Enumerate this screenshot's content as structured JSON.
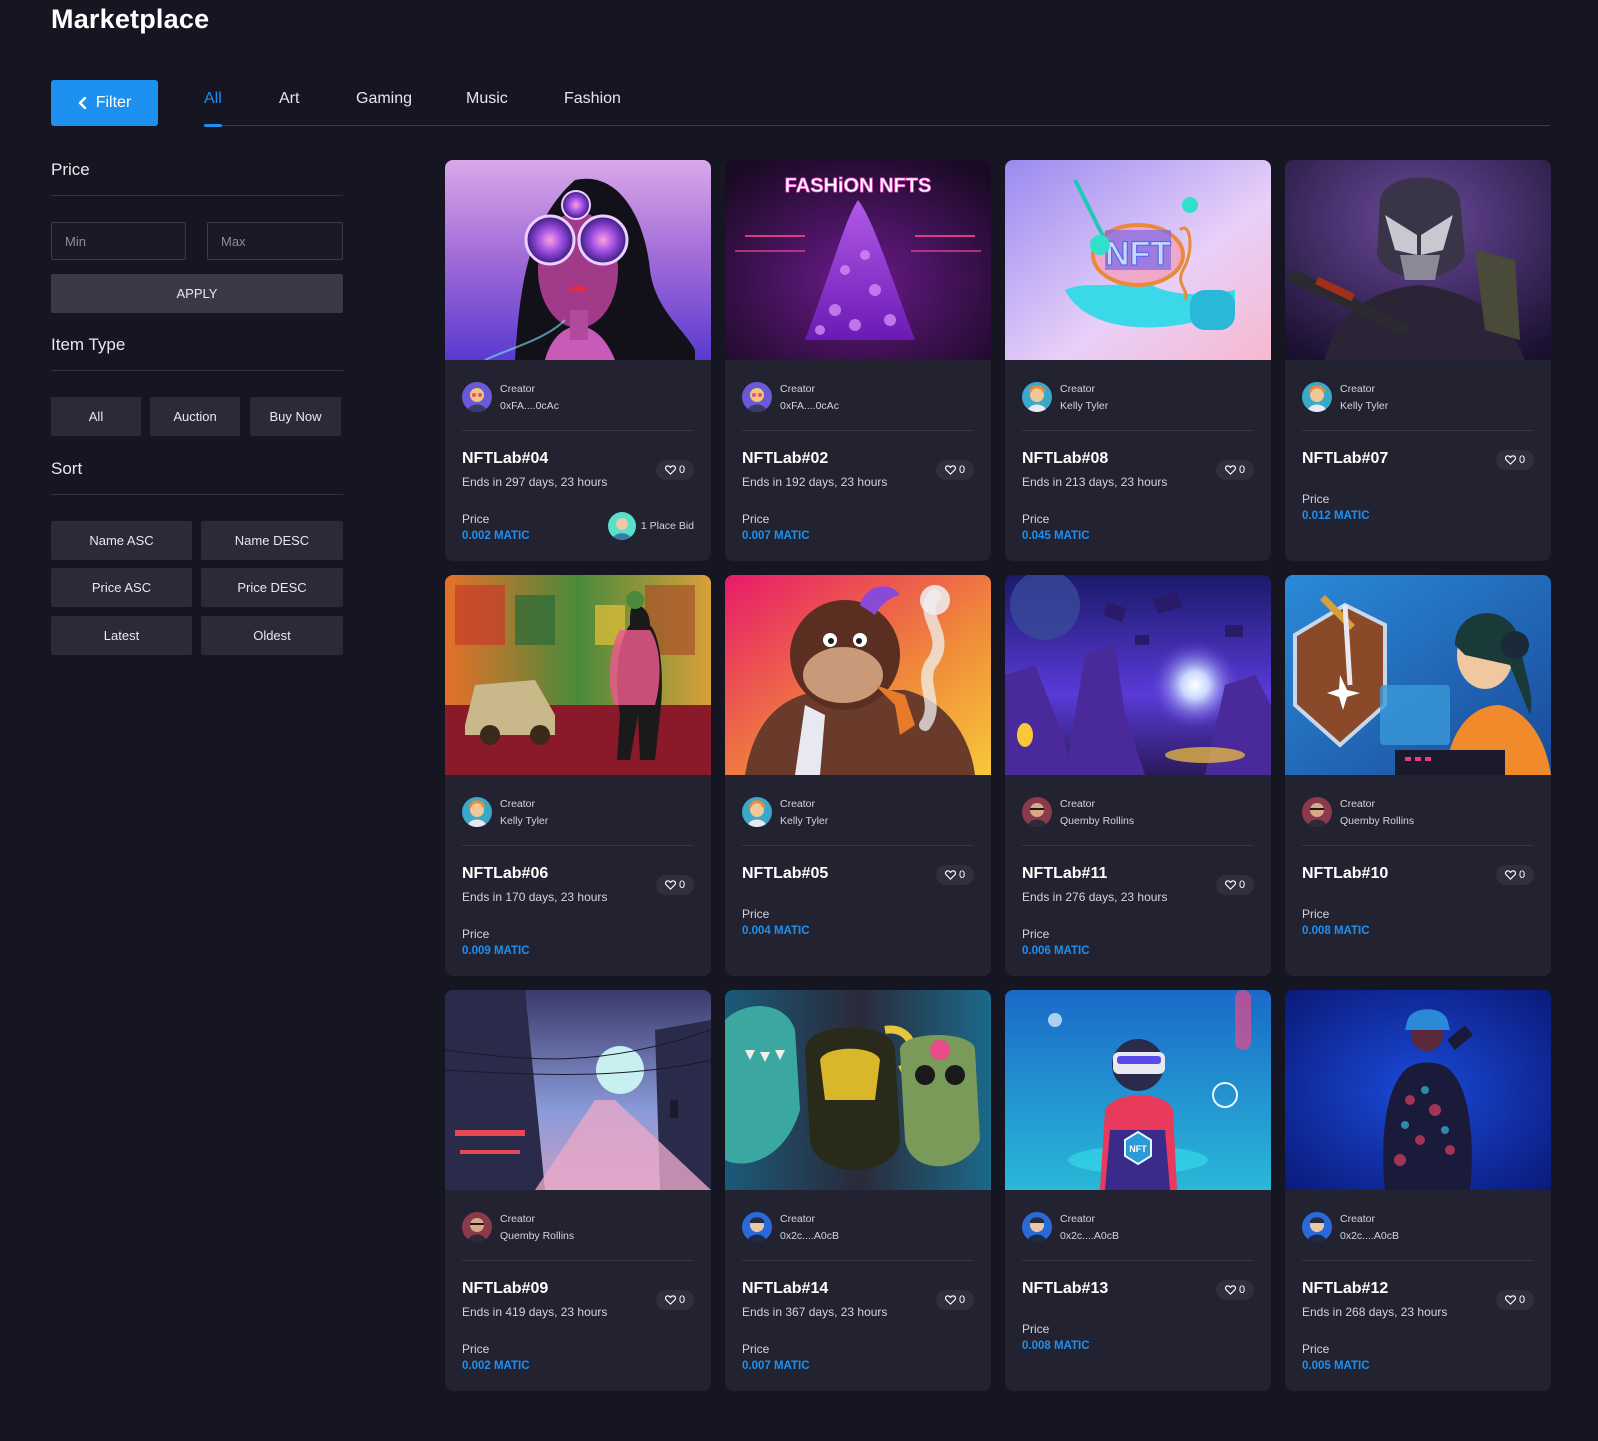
{
  "page_title": "Marketplace",
  "filter_button": "Filter",
  "tabs": [
    {
      "label": "All",
      "active": true
    },
    {
      "label": "Art"
    },
    {
      "label": "Gaming"
    },
    {
      "label": "Music"
    },
    {
      "label": "Fashion"
    }
  ],
  "sidebar": {
    "price_title": "Price",
    "min_placeholder": "Min",
    "max_placeholder": "Max",
    "apply_label": "APPLY",
    "item_type_title": "Item Type",
    "item_types": [
      "All",
      "Auction",
      "Buy Now"
    ],
    "sort_title": "Sort",
    "sort_options": [
      "Name ASC",
      "Name DESC",
      "Price ASC",
      "Price DESC",
      "Latest",
      "Oldest"
    ]
  },
  "accent_color": "#1e90f0",
  "cards": [
    {
      "name": "NFTLab#04",
      "creator_label": "Creator",
      "creator": "0xFA....0cAc",
      "ends": "Ends in 297 days, 23 hours",
      "likes": "0",
      "price_label": "Price",
      "price": "0.002 MATIC",
      "bid_text": "1 Place Bid",
      "art": "woman-cosmic-glasses"
    },
    {
      "name": "NFTLab#02",
      "creator_label": "Creator",
      "creator": "0xFA....0cAc",
      "ends": "Ends in 192 days, 23 hours",
      "likes": "0",
      "price_label": "Price",
      "price": "0.007 MATIC",
      "art": "fashion-nfts-dress",
      "art_text": "FASHiON NFTS"
    },
    {
      "name": "NFTLab#08",
      "creator_label": "Creator",
      "creator": "Kelly Tyler",
      "ends": "Ends in 213 days, 23 hours",
      "likes": "0",
      "price_label": "Price",
      "price": "0.045 MATIC",
      "art": "music-nft-hand",
      "art_text": "NFT"
    },
    {
      "name": "NFTLab#07",
      "creator_label": "Creator",
      "creator": "Kelly Tyler",
      "likes": "0",
      "price_label": "Price",
      "price": "0.012 MATIC",
      "art": "armored-soldier"
    },
    {
      "name": "NFTLab#06",
      "creator_label": "Creator",
      "creator": "Kelly Tyler",
      "ends": "Ends in 170 days, 23 hours",
      "likes": "0",
      "price_label": "Price",
      "price": "0.009 MATIC",
      "art": "fashion-street-car"
    },
    {
      "name": "NFTLab#05",
      "creator_label": "Creator",
      "creator": "Kelly Tyler",
      "likes": "0",
      "price_label": "Price",
      "price": "0.004 MATIC",
      "art": "gorilla-pipe"
    },
    {
      "name": "NFTLab#11",
      "creator_label": "Creator",
      "creator": "Quemby Rollins",
      "ends": "Ends in 276 days, 23 hours",
      "likes": "0",
      "price_label": "Price",
      "price": "0.006 MATIC",
      "art": "purple-planet-landscape"
    },
    {
      "name": "NFTLab#10",
      "creator_label": "Creator",
      "creator": "Quemby Rollins",
      "likes": "0",
      "price_label": "Price",
      "price": "0.008 MATIC",
      "art": "gamer-girl-shield"
    },
    {
      "name": "NFTLab#09",
      "creator_label": "Creator",
      "creator": "Quemby Rollins",
      "ends": "Ends in 419 days, 23 hours",
      "likes": "0",
      "price_label": "Price",
      "price": "0.002 MATIC",
      "art": "city-street-moon"
    },
    {
      "name": "NFTLab#14",
      "creator_label": "Creator",
      "creator": "0x2c....A0cB",
      "ends": "Ends in 367 days, 23 hours",
      "likes": "0",
      "price_label": "Price",
      "price": "0.007 MATIC",
      "art": "monster-figures"
    },
    {
      "name": "NFTLab#13",
      "creator_label": "Creator",
      "creator": "0x2c....A0cB",
      "likes": "0",
      "price_label": "Price",
      "price": "0.008 MATIC",
      "art": "vr-gamer",
      "art_text": "NFT"
    },
    {
      "name": "NFTLab#12",
      "creator_label": "Creator",
      "creator": "0x2c....A0cB",
      "ends": "Ends in 268 days, 23 hours",
      "likes": "0",
      "price_label": "Price",
      "price": "0.005 MATIC",
      "art": "blue-fashion-figure"
    }
  ]
}
